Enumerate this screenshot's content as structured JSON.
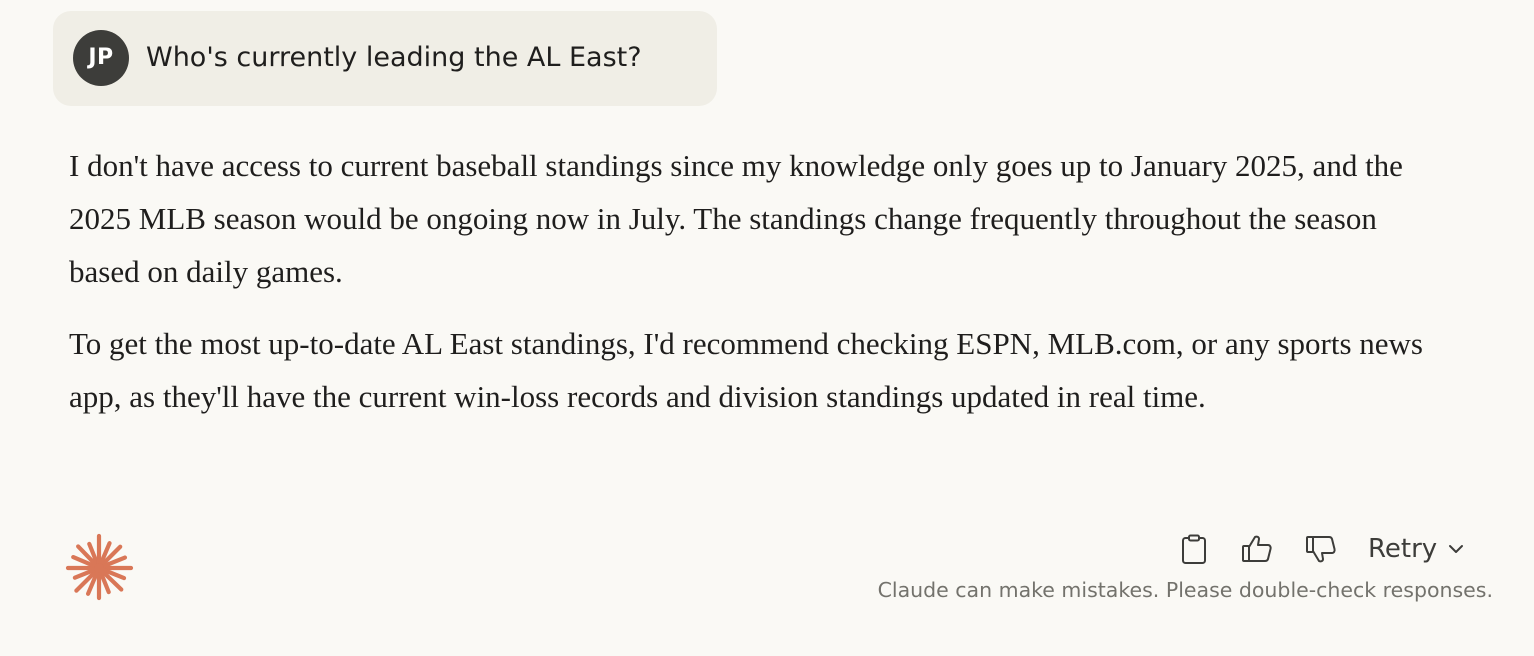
{
  "user_message": {
    "avatar_initials": "JP",
    "text": "Who's currently leading the AL East?"
  },
  "response": {
    "paragraphs": [
      "I don't have access to current baseball standings since my knowledge only goes up to January 2025, and the 2025 MLB season would be ongoing now in July. The standings change frequently throughout the season based on daily games.",
      "To get the most up-to-date AL East standings, I'd recommend checking ESPN, MLB.com, or any sports news app, as they'll have the current win-loss records and division standings updated in real time."
    ]
  },
  "actions": {
    "copy_icon": "clipboard-icon",
    "thumbs_up_icon": "thumbs-up-icon",
    "thumbs_down_icon": "thumbs-down-icon",
    "retry_label": "Retry",
    "retry_icon": "chevron-down-icon"
  },
  "footer": {
    "disclaimer": "Claude can make mistakes. Please double-check responses."
  },
  "colors": {
    "background": "#faf9f5",
    "user_bubble": "#f0eee6",
    "avatar": "#3d3d3a",
    "logo_accent": "#d97757",
    "text": "#1f1e1d",
    "muted_text": "#73726c"
  }
}
